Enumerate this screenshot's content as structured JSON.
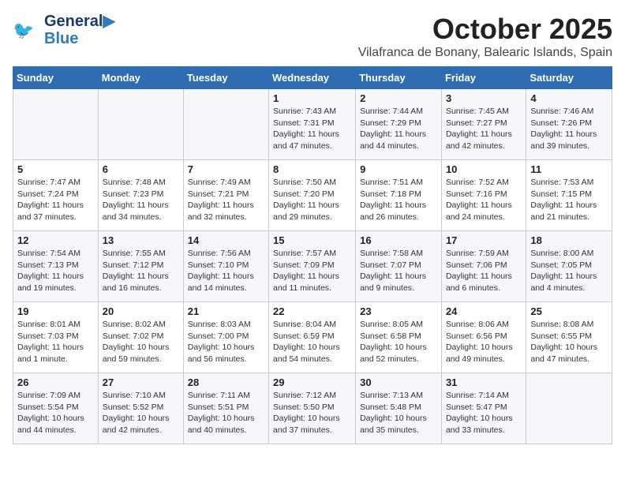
{
  "header": {
    "logo_line1": "General",
    "logo_line2": "Blue",
    "month": "October 2025",
    "location": "Vilafranca de Bonany, Balearic Islands, Spain"
  },
  "days_of_week": [
    "Sunday",
    "Monday",
    "Tuesday",
    "Wednesday",
    "Thursday",
    "Friday",
    "Saturday"
  ],
  "weeks": [
    [
      {
        "day": "",
        "info": ""
      },
      {
        "day": "",
        "info": ""
      },
      {
        "day": "",
        "info": ""
      },
      {
        "day": "1",
        "info": "Sunrise: 7:43 AM\nSunset: 7:31 PM\nDaylight: 11 hours and 47 minutes."
      },
      {
        "day": "2",
        "info": "Sunrise: 7:44 AM\nSunset: 7:29 PM\nDaylight: 11 hours and 44 minutes."
      },
      {
        "day": "3",
        "info": "Sunrise: 7:45 AM\nSunset: 7:27 PM\nDaylight: 11 hours and 42 minutes."
      },
      {
        "day": "4",
        "info": "Sunrise: 7:46 AM\nSunset: 7:26 PM\nDaylight: 11 hours and 39 minutes."
      }
    ],
    [
      {
        "day": "5",
        "info": "Sunrise: 7:47 AM\nSunset: 7:24 PM\nDaylight: 11 hours and 37 minutes."
      },
      {
        "day": "6",
        "info": "Sunrise: 7:48 AM\nSunset: 7:23 PM\nDaylight: 11 hours and 34 minutes."
      },
      {
        "day": "7",
        "info": "Sunrise: 7:49 AM\nSunset: 7:21 PM\nDaylight: 11 hours and 32 minutes."
      },
      {
        "day": "8",
        "info": "Sunrise: 7:50 AM\nSunset: 7:20 PM\nDaylight: 11 hours and 29 minutes."
      },
      {
        "day": "9",
        "info": "Sunrise: 7:51 AM\nSunset: 7:18 PM\nDaylight: 11 hours and 26 minutes."
      },
      {
        "day": "10",
        "info": "Sunrise: 7:52 AM\nSunset: 7:16 PM\nDaylight: 11 hours and 24 minutes."
      },
      {
        "day": "11",
        "info": "Sunrise: 7:53 AM\nSunset: 7:15 PM\nDaylight: 11 hours and 21 minutes."
      }
    ],
    [
      {
        "day": "12",
        "info": "Sunrise: 7:54 AM\nSunset: 7:13 PM\nDaylight: 11 hours and 19 minutes."
      },
      {
        "day": "13",
        "info": "Sunrise: 7:55 AM\nSunset: 7:12 PM\nDaylight: 11 hours and 16 minutes."
      },
      {
        "day": "14",
        "info": "Sunrise: 7:56 AM\nSunset: 7:10 PM\nDaylight: 11 hours and 14 minutes."
      },
      {
        "day": "15",
        "info": "Sunrise: 7:57 AM\nSunset: 7:09 PM\nDaylight: 11 hours and 11 minutes."
      },
      {
        "day": "16",
        "info": "Sunrise: 7:58 AM\nSunset: 7:07 PM\nDaylight: 11 hours and 9 minutes."
      },
      {
        "day": "17",
        "info": "Sunrise: 7:59 AM\nSunset: 7:06 PM\nDaylight: 11 hours and 6 minutes."
      },
      {
        "day": "18",
        "info": "Sunrise: 8:00 AM\nSunset: 7:05 PM\nDaylight: 11 hours and 4 minutes."
      }
    ],
    [
      {
        "day": "19",
        "info": "Sunrise: 8:01 AM\nSunset: 7:03 PM\nDaylight: 11 hours and 1 minute."
      },
      {
        "day": "20",
        "info": "Sunrise: 8:02 AM\nSunset: 7:02 PM\nDaylight: 10 hours and 59 minutes."
      },
      {
        "day": "21",
        "info": "Sunrise: 8:03 AM\nSunset: 7:00 PM\nDaylight: 10 hours and 56 minutes."
      },
      {
        "day": "22",
        "info": "Sunrise: 8:04 AM\nSunset: 6:59 PM\nDaylight: 10 hours and 54 minutes."
      },
      {
        "day": "23",
        "info": "Sunrise: 8:05 AM\nSunset: 6:58 PM\nDaylight: 10 hours and 52 minutes."
      },
      {
        "day": "24",
        "info": "Sunrise: 8:06 AM\nSunset: 6:56 PM\nDaylight: 10 hours and 49 minutes."
      },
      {
        "day": "25",
        "info": "Sunrise: 8:08 AM\nSunset: 6:55 PM\nDaylight: 10 hours and 47 minutes."
      }
    ],
    [
      {
        "day": "26",
        "info": "Sunrise: 7:09 AM\nSunset: 5:54 PM\nDaylight: 10 hours and 44 minutes."
      },
      {
        "day": "27",
        "info": "Sunrise: 7:10 AM\nSunset: 5:52 PM\nDaylight: 10 hours and 42 minutes."
      },
      {
        "day": "28",
        "info": "Sunrise: 7:11 AM\nSunset: 5:51 PM\nDaylight: 10 hours and 40 minutes."
      },
      {
        "day": "29",
        "info": "Sunrise: 7:12 AM\nSunset: 5:50 PM\nDaylight: 10 hours and 37 minutes."
      },
      {
        "day": "30",
        "info": "Sunrise: 7:13 AM\nSunset: 5:48 PM\nDaylight: 10 hours and 35 minutes."
      },
      {
        "day": "31",
        "info": "Sunrise: 7:14 AM\nSunset: 5:47 PM\nDaylight: 10 hours and 33 minutes."
      },
      {
        "day": "",
        "info": ""
      }
    ]
  ]
}
